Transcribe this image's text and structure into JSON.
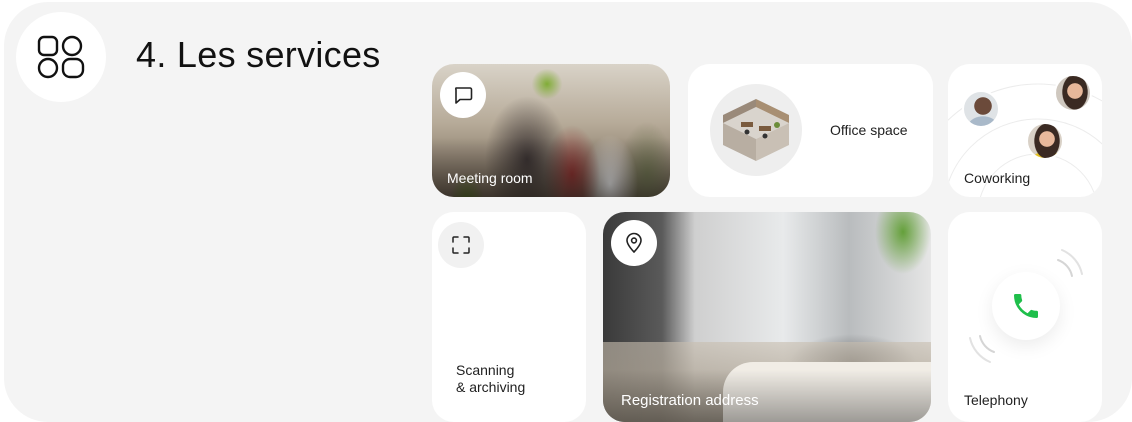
{
  "section": {
    "title": "4. Les services",
    "icon": "services-grid-icon"
  },
  "services": {
    "meeting_room": {
      "label": "Meeting room",
      "icon": "chat-bubble-icon"
    },
    "office_space": {
      "label": "Office space",
      "icon": "office-illustration-icon"
    },
    "coworking": {
      "label": "Coworking",
      "icon": "avatars-icon"
    },
    "scanning": {
      "label_line1": "Scanning",
      "label_line2": "& archiving",
      "icon": "scan-frame-icon"
    },
    "registration": {
      "label": "Registration address",
      "icon": "location-pin-icon"
    },
    "telephony": {
      "label": "Telephony",
      "icon": "phone-icon"
    }
  },
  "colors": {
    "panel_bg": "#f4f4f4",
    "card_bg": "#ffffff",
    "phone_green": "#1fbf4b"
  }
}
